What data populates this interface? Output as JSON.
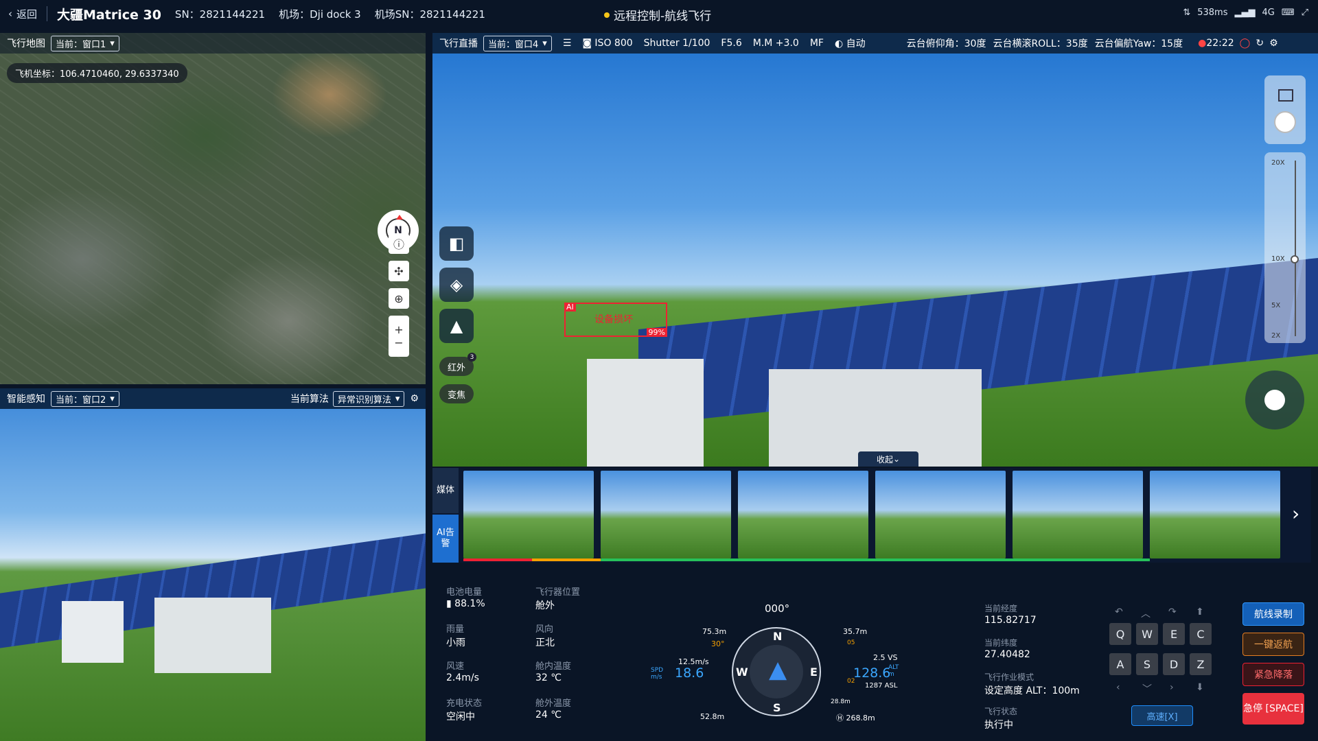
{
  "topbar": {
    "back": "返回",
    "model": "大疆Matrice 30",
    "sn": "SN：2821144221",
    "dock": "机场：Dji dock 3",
    "dock_sn": "机场SN：2821144221",
    "mode": "远程控制-航线飞行",
    "latency": "538ms",
    "signal": "4G"
  },
  "map": {
    "title": "飞行地图",
    "window": "当前：窗口1",
    "coord": "飞机坐标：106.4710460, 29.6337340",
    "compass_n": "N"
  },
  "smart": {
    "title": "智能感知",
    "window": "当前：窗口2",
    "algo_label": "当前算法",
    "algo": "异常识别算法"
  },
  "live": {
    "title": "飞行直播",
    "window": "当前：窗口4",
    "iso": "ISO 800",
    "shutter": "Shutter 1/100",
    "f": "F5.6",
    "mm": "M.M +3.0",
    "mf": "MF",
    "auto": "自动",
    "pitch": "云台俯仰角：30度",
    "roll": "云台横滚ROLL：35度",
    "yaw": "云台偏航Yaw：15度",
    "time": "22:22",
    "ir": "红外",
    "ir_badge": "3",
    "zoom": "变焦",
    "ai_tag": "AI",
    "ai_label": "设备损坏",
    "ai_pct": "99%",
    "z20": "20X",
    "z10": "10X",
    "z5": "5X",
    "z2": "2X",
    "collapse": "收起"
  },
  "strip": {
    "media": "媒体",
    "ai": "AI告警"
  },
  "status": {
    "battery_l": "电池电量",
    "battery": "88.1%",
    "pos_l": "飞行器位置",
    "pos": "舱外",
    "rain_l": "雨量",
    "rain": "小雨",
    "wdir_l": "风向",
    "wdir": "正北",
    "wspd_l": "风速",
    "wspd": "2.4m/s",
    "tin_l": "舱内温度",
    "tin": "32 ℃",
    "charge_l": "充电状态",
    "charge": "空闲中",
    "tout_l": "舱外温度",
    "tout": "24 ℃"
  },
  "hud": {
    "heading": "000°",
    "top_left": "75.3m",
    "top_right": "35.7m",
    "pitch": "30°",
    "wind": "12.5m/s",
    "spd_l": "SPD m/s",
    "spd": "18.6",
    "vs": "2.5 VS",
    "alt": "128.6",
    "alt_l": "ALT m",
    "asl": "1287 ASL",
    "bot_left": "52.8m",
    "bot_right": "268.8m",
    "m05": "05",
    "m02": "02",
    "m288": "28.8m"
  },
  "position": {
    "lon_l": "当前经度",
    "lon": "115.82717",
    "lat_l": "当前纬度",
    "lat": "27.40482",
    "mode_l": "飞行作业模式",
    "mode": "设定高度 ALT：100m",
    "state_l": "飞行状态",
    "state": "执行中"
  },
  "keys": [
    "Q",
    "W",
    "E",
    "C",
    "A",
    "S",
    "D",
    "Z"
  ],
  "speed": "高速[X]",
  "actions": {
    "record": "航线录制",
    "home": "一键返航",
    "land": "紧急降落",
    "stop": "急停 [SPACE]"
  }
}
